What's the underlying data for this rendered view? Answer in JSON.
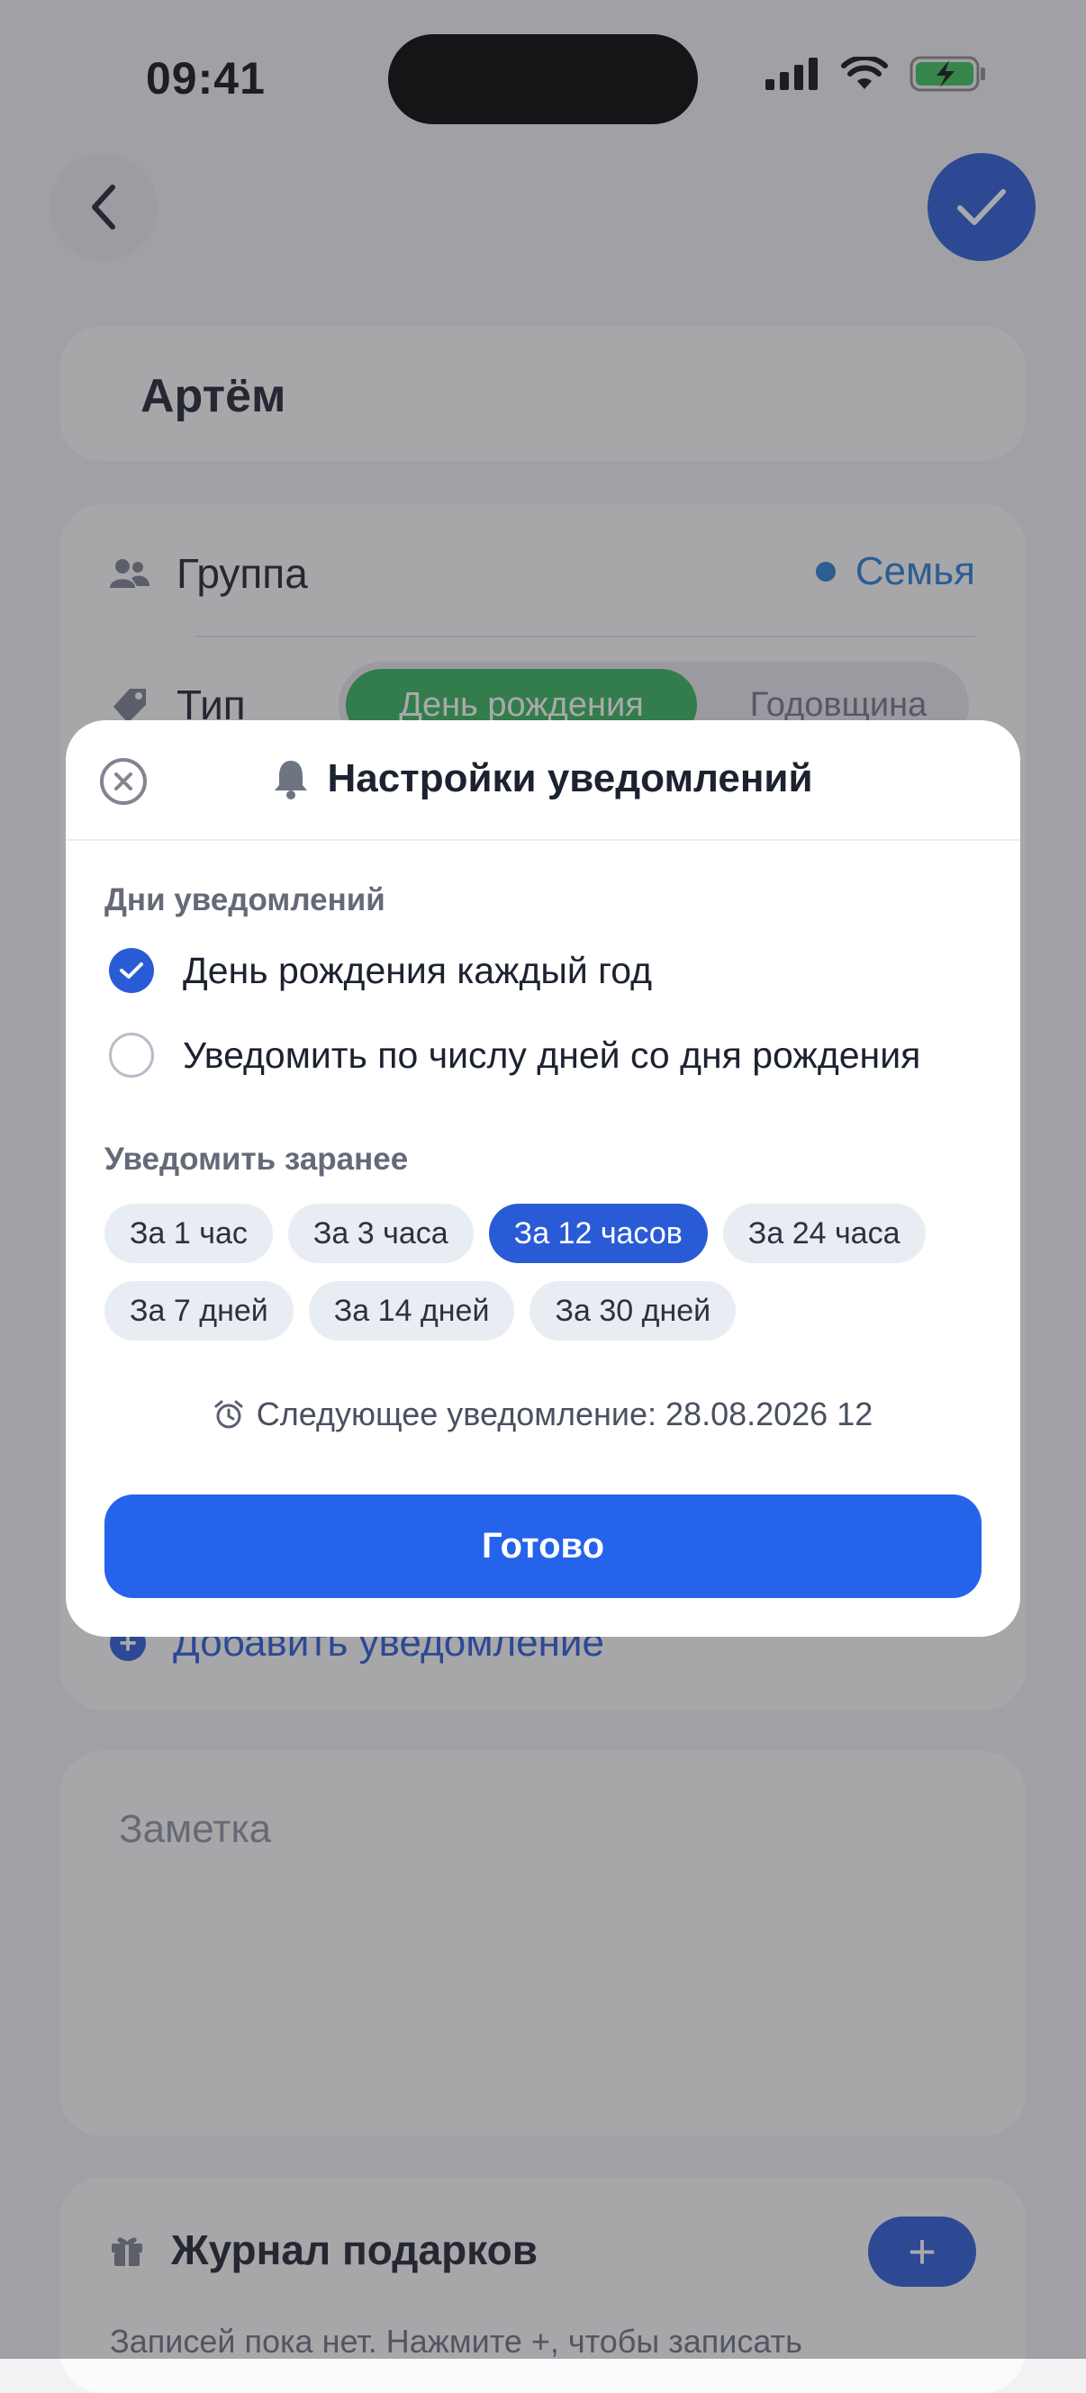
{
  "status_bar": {
    "time": "09:41"
  },
  "contact": {
    "name": "Артём"
  },
  "details": {
    "group_label": "Группа",
    "group_value": "Семья",
    "type_label": "Тип",
    "type_options": [
      "День рождения",
      "Годовщина"
    ],
    "type_selected": "День рождения",
    "add_notification": "Добавить уведомление"
  },
  "note": {
    "placeholder": "Заметка"
  },
  "gifts": {
    "title": "Журнал подарков",
    "empty_text": "Записей пока нет. Нажмите +, чтобы записать"
  },
  "modal": {
    "title": "Настройки уведомлений",
    "days_label": "Дни уведомлений",
    "option_1": "День рождения каждый год",
    "option_2": "Уведомить по числу дней со дня рождения",
    "option_selected": 1,
    "advance_label": "Уведомить заранее",
    "chips": [
      "За 1 час",
      "За 3 часа",
      "За 12 часов",
      "За 24 часа",
      "За 7 дней",
      "За 14 дней",
      "За 30 дней"
    ],
    "chip_selected": "За 12 часов",
    "next_notification": "Следующее уведомление: 28.08.2026 12",
    "done_label": "Готово"
  },
  "colors": {
    "accent": "#2563eb",
    "type_active": "#33b35a",
    "group": "#2a7dd4"
  }
}
